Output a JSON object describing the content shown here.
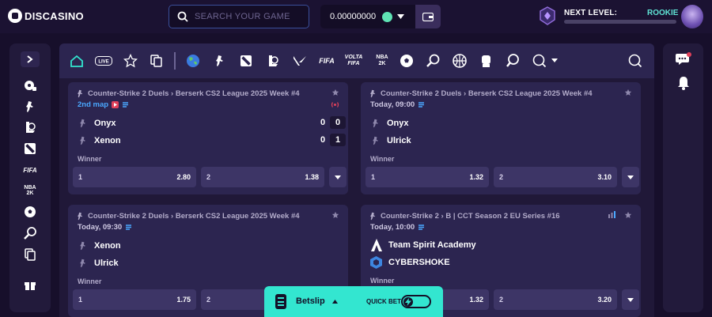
{
  "brand": {
    "name": "DISCASINO"
  },
  "search": {
    "placeholder": "SEARCH YOUR GAME"
  },
  "wallet": {
    "balance": "0.00000000"
  },
  "level": {
    "label": "NEXT LEVEL:",
    "rank": "ROOKIE",
    "progress": 0
  },
  "cards": [
    {
      "header": "Counter-Strike 2 Duels › Berserk CS2 League 2025 Week #4",
      "status": "2nd map",
      "live": true,
      "team1": "Onyx",
      "team2": "Xenon",
      "score1": "0",
      "score2": "0",
      "map1": "0",
      "map2": "1",
      "market": "Winner",
      "odd1_label": "1",
      "odd1": "2.80",
      "odd2_label": "2",
      "odd2": "1.38"
    },
    {
      "header": "Counter-Strike 2 Duels › Berserk CS2 League 2025 Week #4",
      "status": "Today, 09:00",
      "team1": "Onyx",
      "team2": "Ulrick",
      "market": "Winner",
      "odd1_label": "1",
      "odd1": "1.32",
      "odd2_label": "2",
      "odd2": "3.10"
    },
    {
      "header": "Counter-Strike 2 Duels › Berserk CS2 League 2025 Week #4",
      "status": "Today, 09:30",
      "team1": "Xenon",
      "team2": "Ulrick",
      "market": "Winner",
      "odd1_label": "1",
      "odd1": "1.75",
      "odd2_label": "2",
      "odd2": ""
    },
    {
      "header": "Counter-Strike 2 › B | CCT Season 2 EU Series #16",
      "status": "Today, 10:00",
      "team1": "Team Spirit Academy",
      "team2": "CYBERSHOKE",
      "market": "Winner",
      "odd1_label": "1",
      "odd1": "1.32",
      "odd2_label": "2",
      "odd2": "3.20"
    }
  ],
  "betslip": {
    "label": "Betslip",
    "quick_bet": "QUICK BET"
  },
  "colors": {
    "accent": "#33e6d0",
    "bg": "#170f2b",
    "card": "#2c2550",
    "live": "#e0405a",
    "link": "#4aa8ff"
  }
}
